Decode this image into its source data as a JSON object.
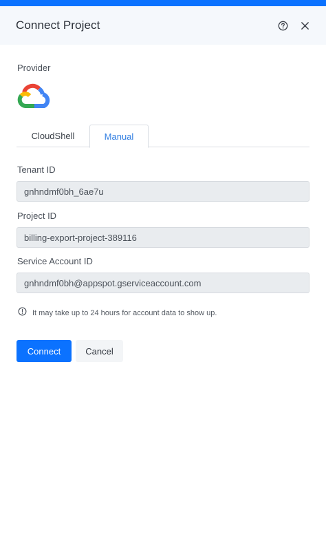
{
  "header": {
    "title": "Connect Project",
    "help_icon": "help-circle-icon",
    "close_icon": "close-icon"
  },
  "provider": {
    "label": "Provider",
    "logo": "google-cloud-logo"
  },
  "tabs": [
    {
      "label": "CloudShell",
      "active": false
    },
    {
      "label": "Manual",
      "active": true
    }
  ],
  "form": {
    "tenant": {
      "label": "Tenant ID",
      "value": "gnhndmf0bh_6ae7u"
    },
    "project": {
      "label": "Project ID",
      "value": "billing-export-project-389116"
    },
    "service_account": {
      "label": "Service Account ID",
      "value": "gnhndmf0bh@appspot.gserviceaccount.com"
    }
  },
  "notice": {
    "icon": "info-circle-icon",
    "text": "It may take up to 24 hours for account data to show up."
  },
  "actions": {
    "connect_label": "Connect",
    "cancel_label": "Cancel"
  },
  "colors": {
    "accent": "#0b72ff",
    "active_tab_text": "#2f7de1",
    "header_bg": "#f5f8fc"
  }
}
